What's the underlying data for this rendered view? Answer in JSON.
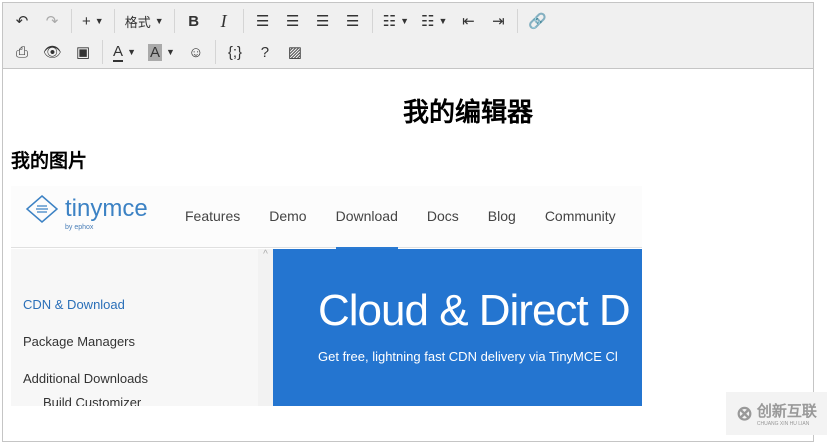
{
  "toolbar": {
    "row1": [
      {
        "name": "undo-button",
        "icon": "↶"
      },
      {
        "name": "redo-button",
        "icon": "↷",
        "disabled": true
      },
      {
        "sep": true
      },
      {
        "name": "insert-button",
        "icon": "+",
        "caret": true
      },
      {
        "sep": true
      },
      {
        "name": "format-button",
        "label": "格式",
        "caret": true
      },
      {
        "sep": true
      },
      {
        "name": "bold-button",
        "icon": "B"
      },
      {
        "name": "italic-button",
        "icon": "I"
      },
      {
        "sep": true
      },
      {
        "name": "align-left-button",
        "icon": "☰"
      },
      {
        "name": "align-center-button",
        "icon": "☰"
      },
      {
        "name": "align-right-button",
        "icon": "☰"
      },
      {
        "name": "justify-button",
        "icon": "☰"
      },
      {
        "sep": true
      },
      {
        "name": "bullet-list-button",
        "icon": "☷",
        "caret": true
      },
      {
        "name": "numbered-list-button",
        "icon": "☷",
        "caret": true
      },
      {
        "name": "outdent-button",
        "icon": "⇤"
      },
      {
        "name": "indent-button",
        "icon": "⇥"
      },
      {
        "sep": true
      },
      {
        "name": "link-button",
        "icon": "🔗"
      }
    ],
    "row2": [
      {
        "name": "print-button",
        "icon": "⎙"
      },
      {
        "name": "preview-button",
        "icon": "👁"
      },
      {
        "name": "media-button",
        "icon": "▣"
      },
      {
        "sep": true
      },
      {
        "name": "text-color-button",
        "icon": "A",
        "caret": true
      },
      {
        "name": "background-color-button",
        "icon": "A",
        "caret": true
      },
      {
        "name": "emoticons-button",
        "icon": "☺"
      },
      {
        "sep": true
      },
      {
        "name": "code-sample-button",
        "icon": "{;}"
      },
      {
        "name": "help-button",
        "icon": "?"
      },
      {
        "name": "image-button",
        "icon": "▨"
      }
    ]
  },
  "content": {
    "heading": "我的编辑器",
    "subheading": "我的图片",
    "image": {
      "logo": "tinymce",
      "logo_by": "by ephox",
      "nav": [
        "Features",
        "Demo",
        "Download",
        "Docs",
        "Blog",
        "Community"
      ],
      "sidebar": [
        "CDN & Download",
        "Package Managers",
        "Additional Downloads",
        "Build Customizer"
      ],
      "hero_title": "Cloud & Direct D",
      "hero_sub": "Get free, lightning fast CDN delivery via TinyMCE Cl",
      "accent": "#2475d0"
    }
  },
  "watermark": {
    "text": "创新互联",
    "sub": "CHUANG XIN HU LIAN"
  }
}
